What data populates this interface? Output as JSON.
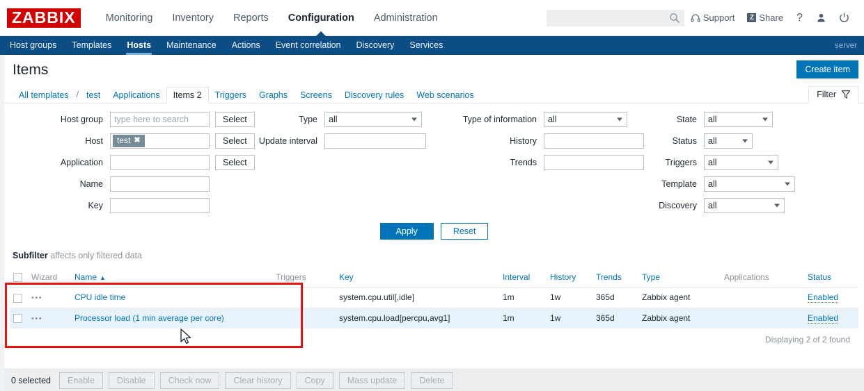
{
  "header": {
    "logo": "ZABBIX",
    "nav": [
      {
        "label": "Monitoring",
        "active": false
      },
      {
        "label": "Inventory",
        "active": false
      },
      {
        "label": "Reports",
        "active": false
      },
      {
        "label": "Configuration",
        "active": true
      },
      {
        "label": "Administration",
        "active": false
      }
    ],
    "search_placeholder": "",
    "search_value": "",
    "support_label": "Support",
    "share_label": "Share",
    "share_badge": "Z",
    "help_label": "?"
  },
  "subnav": {
    "items": [
      {
        "label": "Host groups",
        "active": false
      },
      {
        "label": "Templates",
        "active": false
      },
      {
        "label": "Hosts",
        "active": true
      },
      {
        "label": "Maintenance",
        "active": false
      },
      {
        "label": "Actions",
        "active": false
      },
      {
        "label": "Event correlation",
        "active": false
      },
      {
        "label": "Discovery",
        "active": false
      },
      {
        "label": "Services",
        "active": false
      }
    ],
    "server_label": "server"
  },
  "page": {
    "title": "Items",
    "create_button": "Create item"
  },
  "objtabs": {
    "crumb_root": "All templates",
    "crumb_sep": "/",
    "crumb_host": "test",
    "tabs": [
      {
        "label": "Applications",
        "selected": false
      },
      {
        "label": "Items 2",
        "selected": true
      },
      {
        "label": "Triggers",
        "selected": false
      },
      {
        "label": "Graphs",
        "selected": false
      },
      {
        "label": "Screens",
        "selected": false
      },
      {
        "label": "Discovery rules",
        "selected": false
      },
      {
        "label": "Web scenarios",
        "selected": false
      }
    ],
    "filter_label": "Filter"
  },
  "filter": {
    "host_group": {
      "label": "Host group",
      "placeholder": "type here to search",
      "value": "",
      "select_label": "Select"
    },
    "host": {
      "label": "Host",
      "chip": "test",
      "chip_remove": "✖",
      "select_label": "Select"
    },
    "application": {
      "label": "Application",
      "value": "",
      "select_label": "Select"
    },
    "name": {
      "label": "Name",
      "value": ""
    },
    "key": {
      "label": "Key",
      "value": ""
    },
    "type": {
      "label": "Type",
      "value": "all"
    },
    "update_interval": {
      "label": "Update interval",
      "value": ""
    },
    "type_of_information": {
      "label": "Type of information",
      "value": "all"
    },
    "history": {
      "label": "History",
      "value": ""
    },
    "trends": {
      "label": "Trends",
      "value": ""
    },
    "state": {
      "label": "State",
      "value": "all"
    },
    "status": {
      "label": "Status",
      "value": "all"
    },
    "triggers": {
      "label": "Triggers",
      "value": "all"
    },
    "template": {
      "label": "Template",
      "value": "all"
    },
    "discovery": {
      "label": "Discovery",
      "value": "all"
    },
    "apply_label": "Apply",
    "reset_label": "Reset"
  },
  "subfilter": {
    "title": "Subfilter",
    "hint": "affects only filtered data"
  },
  "table": {
    "columns": {
      "wizard": "Wizard",
      "name": "Name",
      "sort_arrow": "▲",
      "triggers": "Triggers",
      "key": "Key",
      "interval": "Interval",
      "history": "History",
      "trends": "Trends",
      "type": "Type",
      "applications": "Applications",
      "status": "Status"
    },
    "rows": [
      {
        "wizard": "•••",
        "name": "CPU idle time",
        "triggers": "",
        "key": "system.cpu.util[,idle]",
        "interval": "1m",
        "history": "1w",
        "trends": "365d",
        "type": "Zabbix agent",
        "applications": "",
        "status": "Enabled"
      },
      {
        "wizard": "•••",
        "name": "Processor load (1 min average per core)",
        "triggers": "",
        "key": "system.cpu.load[percpu,avg1]",
        "interval": "1m",
        "history": "1w",
        "trends": "365d",
        "type": "Zabbix agent",
        "applications": "",
        "status": "Enabled"
      }
    ],
    "count_text": "Displaying 2 of 2 found"
  },
  "actionbar": {
    "selected_text": "0 selected",
    "buttons": [
      "Enable",
      "Disable",
      "Check now",
      "Clear history",
      "Copy",
      "Mass update",
      "Delete"
    ]
  },
  "colors": {
    "brand_red": "#d40000",
    "nav_blue": "#0c4d86",
    "link_blue": "#0275b8",
    "status_green": "#5b9b37",
    "highlight_red": "#ee1111",
    "row_alt": "#e8f2fb"
  }
}
